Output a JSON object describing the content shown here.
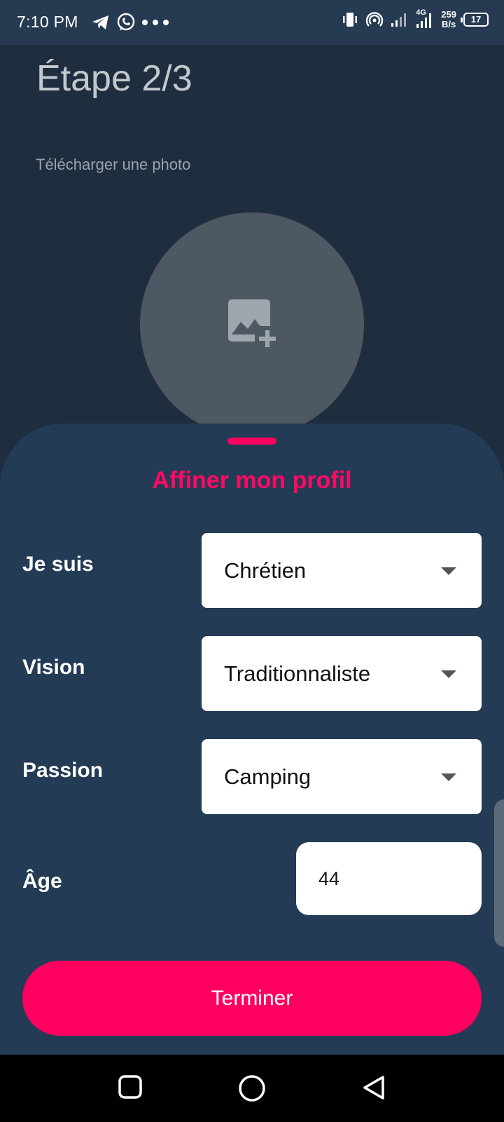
{
  "status_bar": {
    "time": "7:10 PM",
    "left_icons": [
      "telegram-icon",
      "whatsapp-icon",
      "more-dots-icon"
    ],
    "right_icons": [
      "vibrate-icon",
      "hotspot-icon",
      "signal-icon",
      "signal-4g-icon"
    ],
    "net_type": "4G",
    "net_speed_value": "259",
    "net_speed_unit": "B/s",
    "battery": "17"
  },
  "page": {
    "step_title": "Étape 2/3",
    "upload_label": "Télécharger une photo",
    "photo_icon": "add-photo-icon"
  },
  "sheet": {
    "title": "Affiner mon profil",
    "rows": [
      {
        "label": "Je suis",
        "value": "Chrétien"
      },
      {
        "label": "Vision",
        "value": "Traditionnaliste"
      },
      {
        "label": "Passion",
        "value": "Camping"
      }
    ],
    "age": {
      "label": "Âge",
      "value": "44"
    },
    "finish_label": "Terminer"
  },
  "colors": {
    "accent": "#ff0060",
    "sheet_bg": "#243b55",
    "page_bg": "#1f2e3f"
  },
  "nav_bar": {
    "buttons": [
      "recents-square-icon",
      "home-circle-icon",
      "back-triangle-icon"
    ]
  }
}
